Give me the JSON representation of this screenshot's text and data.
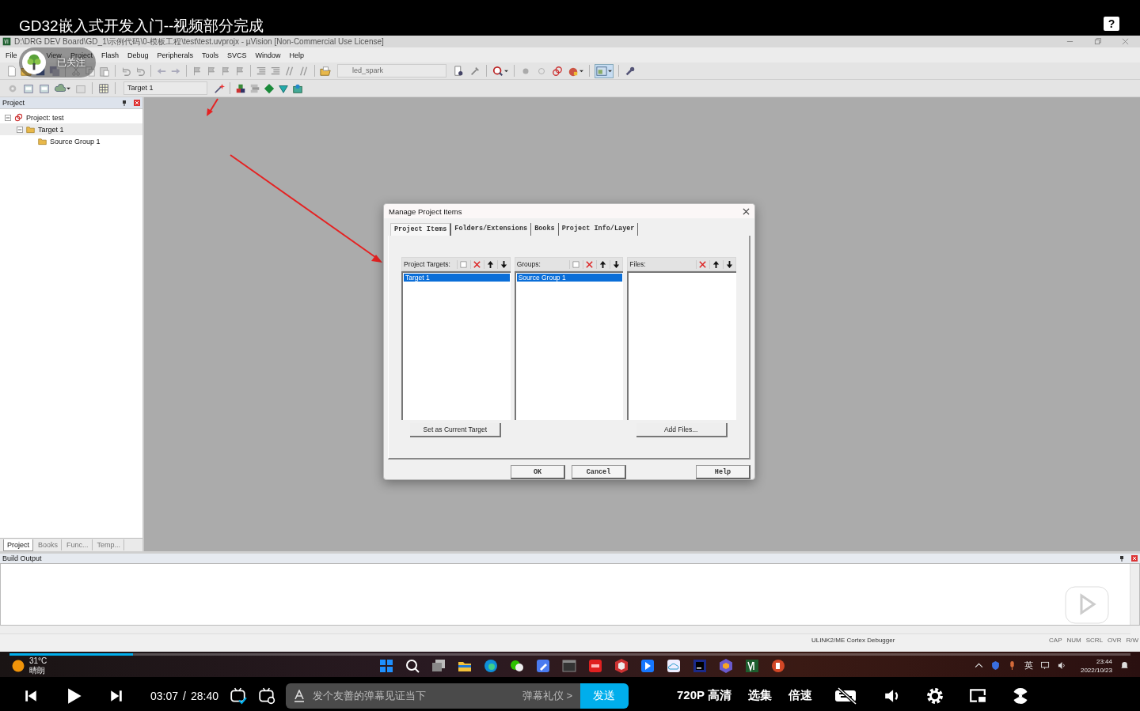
{
  "video": {
    "title": "GD32嵌入式开发入门--视频部分完成",
    "help": "?"
  },
  "follow_badge": {
    "label": "已关注"
  },
  "app": {
    "title": "D:\\DRG DEV Board\\GD_1\\示例代码\\0-模板工程\\test\\test.uvprojx - µVision  [Non-Commercial Use License]",
    "menu": [
      "File",
      "View",
      "Project",
      "Flash",
      "Debug",
      "Peripherals",
      "Tools",
      "SVCS",
      "Window",
      "Help"
    ],
    "config_dropdown": "led_spark",
    "target_dropdown": "Target 1"
  },
  "project_panel": {
    "title": "Project",
    "tree": [
      {
        "label": "Project: test",
        "expanded": true,
        "children": [
          {
            "label": "Target 1",
            "expanded": true,
            "children": [
              {
                "label": "Source Group 1"
              }
            ]
          }
        ]
      }
    ],
    "tabs": [
      {
        "label": "Project",
        "selected": true
      },
      {
        "label": "Books",
        "selected": false
      },
      {
        "label": "Func...",
        "selected": false
      },
      {
        "label": "Temp...",
        "selected": false
      }
    ]
  },
  "dialog": {
    "title": "Manage Project Items",
    "tabs": [
      {
        "label": "Project Items",
        "selected": true
      },
      {
        "label": "Folders/Extensions",
        "selected": false
      },
      {
        "label": "Books",
        "selected": false
      },
      {
        "label": "Project Info/Layer",
        "selected": false
      }
    ],
    "panes": [
      {
        "label": "Project Targets:",
        "new_button": true,
        "items": [
          {
            "label": "Target 1",
            "selected": true
          }
        ],
        "action": "Set as Current Target"
      },
      {
        "label": "Groups:",
        "new_button": true,
        "items": [
          {
            "label": "Source Group 1",
            "selected": true
          }
        ]
      },
      {
        "label": "Files:",
        "new_button": false,
        "action": "Add Files..."
      }
    ],
    "buttons": [
      "OK",
      "Cancel",
      "Help"
    ]
  },
  "build_output": {
    "title": "Build Output"
  },
  "status_bar": {
    "debugger": "ULINK2/ME Cortex Debugger",
    "indicators": [
      "CAP",
      "NUM",
      "SCRL",
      "OVR",
      "R/W"
    ]
  },
  "taskbar": {
    "temperature": "31°C",
    "condition": "晴朗",
    "language": "英",
    "time": "23:44",
    "date": "2022/10/23"
  },
  "player": {
    "progress": {
      "level": 0.11
    },
    "current_time": "03:07",
    "separator": "/",
    "duration": "28:40",
    "danmaku_placeholder": "发个友善的弹幕见证当下",
    "etiquette": "弹幕礼仪 >",
    "send": "发送",
    "quality": "720P 高清",
    "episodes": "选集",
    "speed": "倍速"
  }
}
